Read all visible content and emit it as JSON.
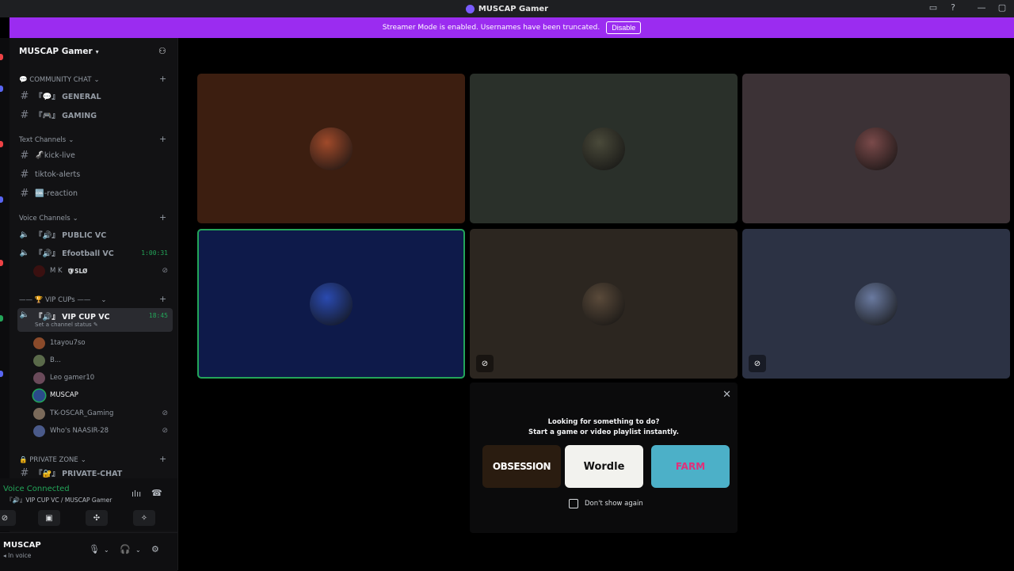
{
  "window": {
    "title": "MUSCAP Gamer"
  },
  "banner": {
    "text": "Streamer Mode is enabled. Usernames have been truncated.",
    "button_label": "Disable"
  },
  "server": {
    "name": "MUSCAP Gamer"
  },
  "categories": {
    "community": "💬 COMMUNITY CHAT",
    "text": "Text Channels",
    "voice": "Voice Channels",
    "vip": "—— 🏆 VIP CUPs ——",
    "private": "🔒 PRIVATE ZONE"
  },
  "channels": {
    "general": "『💬』 GENERAL",
    "gaming": "『🎮』 GAMING",
    "kick_live": "🦨kick-live",
    "tiktok_alerts": "tiktok-alerts",
    "reaction": "🆒-reaction",
    "public_vc": "『🔊』 PUBLIC VC",
    "efootball_vc": "『🔊』 Efootball VC",
    "efootball_timer": "1:00:31",
    "vip_cup_vc": "『🔊』 VIP CUP VC",
    "vip_timer": "18:45",
    "vip_status": "Set a channel status ✎",
    "private_chat": "『🔐』 PRIVATE-CHAT"
  },
  "efootball_members": [
    {
      "name": "M K",
      "tag": "🛡SLØ"
    }
  ],
  "vip_members": [
    {
      "name": "1tayou7so",
      "color": "#8a4a2a",
      "muted": false
    },
    {
      "name": "B...",
      "color": "#5a6a4a",
      "muted": false
    },
    {
      "name": "Leo gamer10",
      "color": "#6a4a5a",
      "muted": false
    },
    {
      "name": "MUSCAP",
      "color": "#2a4a8a",
      "muted": false
    },
    {
      "name": "TK-OSCAR_Gaming",
      "color": "#7a6a5a",
      "muted": true
    },
    {
      "name": "Who's NAASIR-28",
      "color": "#4a5a8a",
      "muted": true
    }
  ],
  "voice_panel": {
    "status": "Voice Connected",
    "location": "『🔊』VIP CUP VC / MUSCAP Gamer"
  },
  "user_panel": {
    "name": "MUSCAP",
    "status": "In voice"
  },
  "tiles": [
    {
      "bg": "#3c1e10",
      "avatar": "#a04a2a",
      "muted": false,
      "speaking": false
    },
    {
      "bg": "#2a302a",
      "avatar": "#4a4a3a",
      "muted": false,
      "speaking": false
    },
    {
      "bg": "#3c3236",
      "avatar": "#7a4a4a",
      "muted": false,
      "speaking": false
    },
    {
      "bg": "#0e1a4a",
      "avatar": "#2a4ab0",
      "muted": false,
      "speaking": true
    },
    {
      "bg": "#2c2620",
      "avatar": "#5a4a3a",
      "muted": true,
      "speaking": false
    },
    {
      "bg": "#2c3244",
      "avatar": "#6a7aa0",
      "muted": true,
      "speaking": false
    }
  ],
  "popup": {
    "line1": "Looking for something to do?",
    "line2": "Start a game or video playlist instantly.",
    "games": [
      "OBSESSION",
      "Wordle",
      "FARM"
    ],
    "checkbox_label": "Don't show again"
  }
}
